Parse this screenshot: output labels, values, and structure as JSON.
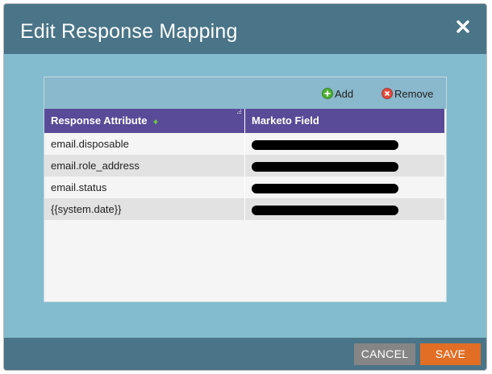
{
  "dialog": {
    "title": "Edit Response Mapping",
    "close_icon": "close-icon"
  },
  "toolbar": {
    "add_label": "Add",
    "add_icon": "plus-circle-icon",
    "remove_label": "Remove",
    "remove_icon": "remove-circle-icon"
  },
  "grid": {
    "columns": [
      "Response Attribute",
      "Marketo Field"
    ],
    "rows": [
      {
        "attribute": "email.disposable",
        "field": "[redacted]"
      },
      {
        "attribute": "email.role_address",
        "field": "[redacted]"
      },
      {
        "attribute": "email.status",
        "field": "[redacted]"
      },
      {
        "attribute": "{{system.date}}",
        "field": "[redacted]"
      }
    ]
  },
  "footer": {
    "cancel_label": "CANCEL",
    "save_label": "SAVE"
  },
  "colors": {
    "titlebar": "#4a7487",
    "body": "#82bcce",
    "grid_header": "#5a4b98",
    "save_button": "#e16e24",
    "cancel_button": "#858585"
  }
}
